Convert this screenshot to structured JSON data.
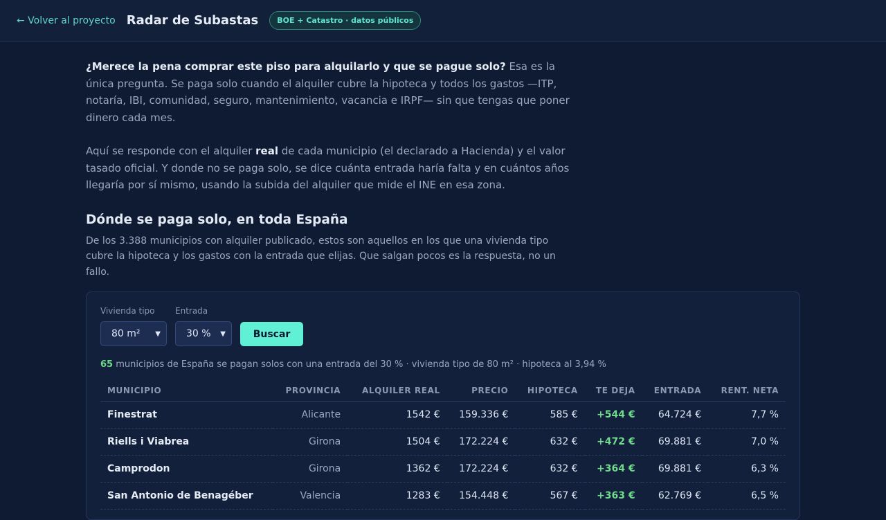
{
  "header": {
    "back_label": "← Volver al proyecto",
    "title": "Radar de Subastas",
    "badge": "BOE + Catastro · datos públicos"
  },
  "intro": {
    "p1_bold": "¿Merece la pena comprar este piso para alquilarlo y que se pague solo?",
    "p1_rest": " Esa es la única pregunta. Se paga solo cuando el alquiler cubre la hipoteca y todos los gastos —ITP, notaría, IBI, comunidad, seguro, mantenimiento, vacancia e IRPF— sin que tengas que poner dinero cada mes.",
    "p2_start": "Aquí se responde con el alquiler ",
    "p2_bold": "real",
    "p2_end": " de cada municipio (el declarado a Hacienda) y el valor tasado oficial. Y donde no se paga solo, se dice cuánta entrada haría falta y en cuántos años llegaría por sí mismo, usando la subida del alquiler que mide el INE en esa zona."
  },
  "section": {
    "title": "Dónde se paga solo, en toda España",
    "description": "De los 3.388 municipios con alquiler publicado, estos son aquellos en los que una vivienda tipo cubre la hipoteca y los gastos con la entrada que elijas. Que salgan pocos es la respuesta, no un fallo."
  },
  "filters": {
    "vivienda_label": "Vivienda tipo",
    "vivienda_value": "80 m²",
    "entrada_label": "Entrada",
    "entrada_value": "30 %",
    "search_label": "Buscar"
  },
  "summary": {
    "count": "65",
    "text": " municipios de España se pagan solos con una entrada del 30 % · vivienda tipo de 80 m² · hipoteca al 3,94 %"
  },
  "table": {
    "headers": [
      "Municipio",
      "Provincia",
      "Alquiler real",
      "Precio",
      "Hipoteca",
      "Te deja",
      "Entrada",
      "Rent. neta"
    ],
    "rows": [
      [
        "Finestrat",
        "Alicante",
        "1542 €",
        "159.336 €",
        "585 €",
        "+544 €",
        "64.724 €",
        "7,7 %"
      ],
      [
        "Riells i Viabrea",
        "Girona",
        "1504 €",
        "172.224 €",
        "632 €",
        "+472 €",
        "69.881 €",
        "7,0 %"
      ],
      [
        "Camprodon",
        "Girona",
        "1362 €",
        "172.224 €",
        "632 €",
        "+364 €",
        "69.881 €",
        "6,3 %"
      ],
      [
        "San Antonio de Benagéber",
        "Valencia",
        "1283 €",
        "154.448 €",
        "567 €",
        "+363 €",
        "62.769 €",
        "6,5 %"
      ]
    ]
  }
}
